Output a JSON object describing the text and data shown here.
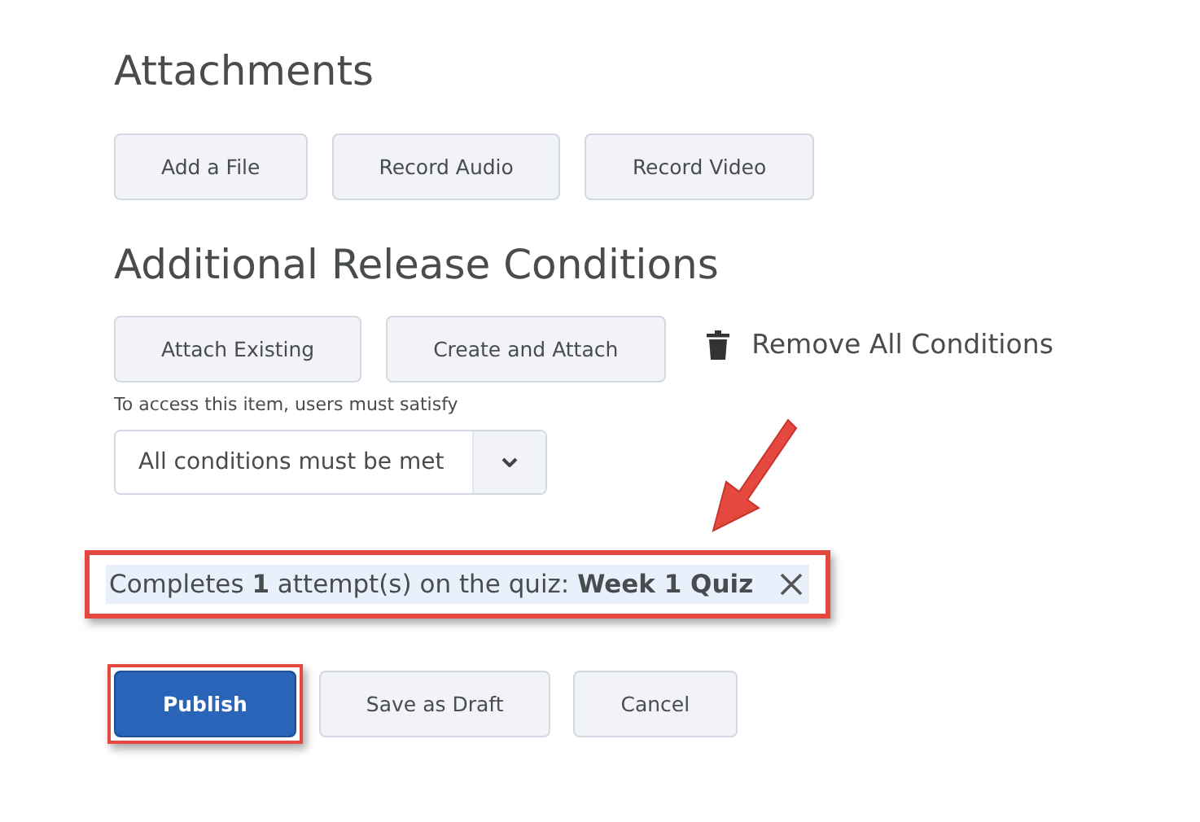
{
  "attachments": {
    "heading": "Attachments",
    "buttons": [
      "Add a File",
      "Record Audio",
      "Record Video"
    ]
  },
  "release_conditions": {
    "heading": "Additional Release Conditions",
    "buttons": [
      "Attach Existing",
      "Create and Attach"
    ],
    "remove_all": "Remove All Conditions",
    "requirement_label": "To access this item, users must satisfy",
    "requirement_select": {
      "value": "All conditions must be met"
    },
    "conditions": [
      {
        "text": "Completes **1** attempt(s) on the quiz: **Week 1 Quiz**",
        "highlighted": true
      }
    ]
  },
  "footer_buttons": [
    {
      "label": "Publish",
      "kind": "primary",
      "highlighted": true
    },
    {
      "label": "Save as Draft",
      "kind": "secondary",
      "highlighted": false
    },
    {
      "label": "Cancel",
      "kind": "secondary",
      "highlighted": false
    }
  ]
}
